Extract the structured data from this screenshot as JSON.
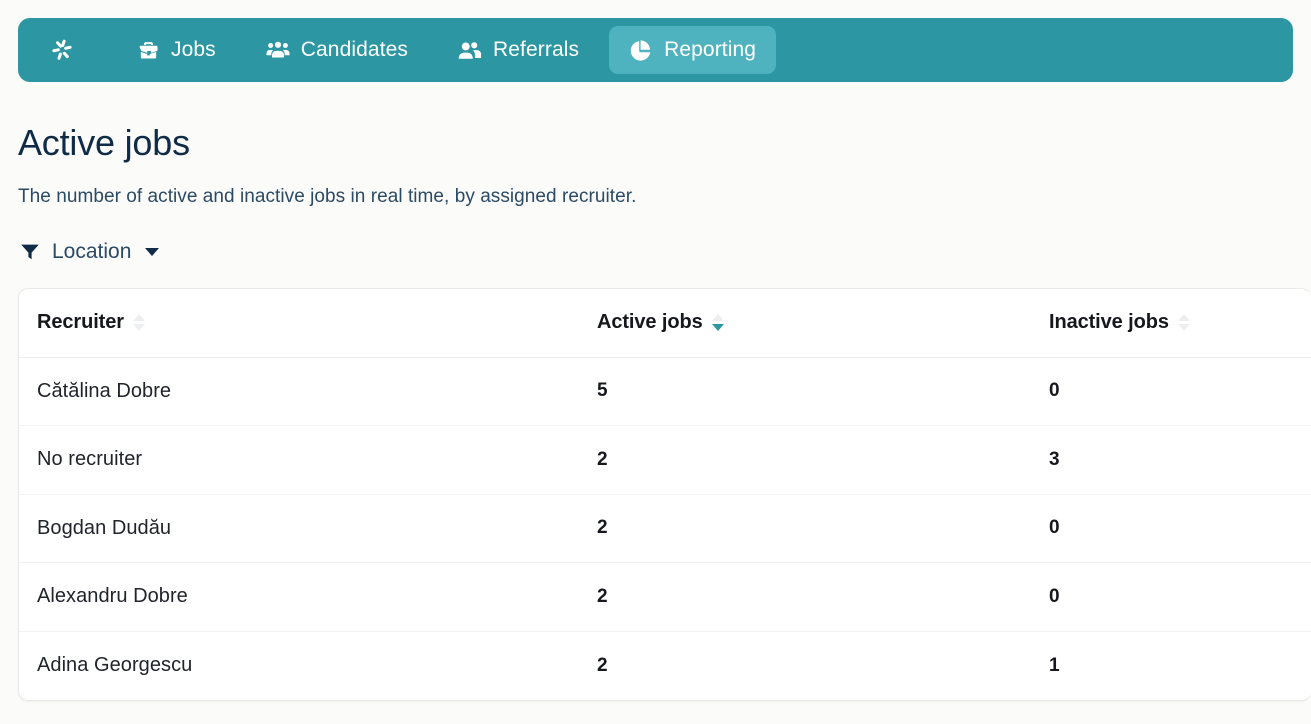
{
  "colors": {
    "navbar_teal": "#2d96a3",
    "active_pill_teal": "#4fb3bf",
    "page_background": "#fbfbf9",
    "title_navy": "#0f2b46",
    "sort_active_teal": "#2d96a3",
    "sort_inactive_gray": "#eceef0"
  },
  "navbar": {
    "brand_icon": "pinwheel-logo-icon",
    "items": [
      {
        "label": "Jobs",
        "icon": "briefcase-icon",
        "active": false
      },
      {
        "label": "Candidates",
        "icon": "users-three-icon",
        "active": false
      },
      {
        "label": "Referrals",
        "icon": "users-two-icon",
        "active": false
      },
      {
        "label": "Reporting",
        "icon": "pie-chart-icon",
        "active": true
      }
    ]
  },
  "page": {
    "title": "Active jobs",
    "subtitle": "The number of active and inactive jobs in real time, by assigned recruiter."
  },
  "filter": {
    "icon": "funnel-icon",
    "label": "Location",
    "caret": "chevron-down-icon"
  },
  "table": {
    "columns": [
      {
        "key": "recruiter",
        "label": "Recruiter",
        "sortable": true,
        "sort": "none"
      },
      {
        "key": "active_jobs",
        "label": "Active jobs",
        "sortable": true,
        "sort": "desc"
      },
      {
        "key": "inactive_jobs",
        "label": "Inactive jobs",
        "sortable": true,
        "sort": "none"
      }
    ],
    "rows": [
      {
        "recruiter": "Cătălina Dobre",
        "active_jobs": "5",
        "inactive_jobs": "0"
      },
      {
        "recruiter": "No recruiter",
        "active_jobs": "2",
        "inactive_jobs": "3"
      },
      {
        "recruiter": "Bogdan Dudău",
        "active_jobs": "2",
        "inactive_jobs": "0"
      },
      {
        "recruiter": "Alexandru Dobre",
        "active_jobs": "2",
        "inactive_jobs": "0"
      },
      {
        "recruiter": "Adina Georgescu",
        "active_jobs": "2",
        "inactive_jobs": "1"
      }
    ]
  }
}
